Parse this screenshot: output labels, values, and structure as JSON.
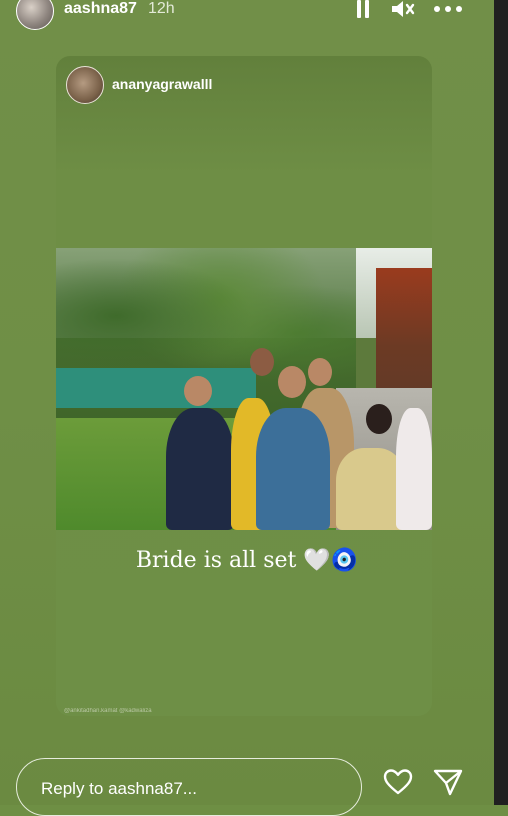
{
  "header": {
    "username": "aashna87",
    "time": "12h",
    "icons": [
      "pause-icon",
      "mute-icon",
      "more-icon"
    ]
  },
  "repost": {
    "username": "ananyagrawalll"
  },
  "caption": "Bride is all set 🤍🧿",
  "watermark": "@ankitadhan.kamat @kadwaliza",
  "reply": {
    "placeholder": "Reply to aashna87..."
  },
  "actions": [
    "heart-icon",
    "send-icon"
  ],
  "colors": {
    "background": "#6e8f44",
    "text": "#ffffff"
  }
}
